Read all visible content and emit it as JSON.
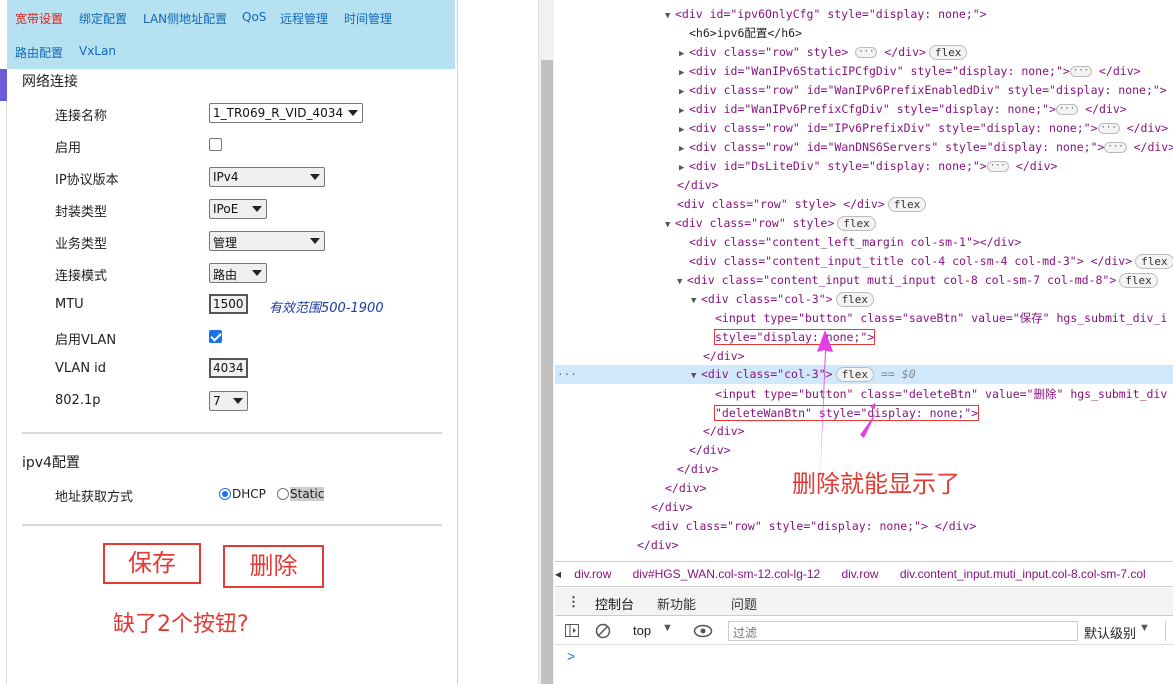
{
  "top_nav": {
    "tabs": [
      {
        "label": "宽带设置",
        "active": true
      },
      {
        "label": "绑定配置"
      },
      {
        "label": "LAN侧地址配置"
      },
      {
        "label": "QoS"
      },
      {
        "label": "远程管理"
      },
      {
        "label": "时间管理"
      },
      {
        "label": "路由配置"
      },
      {
        "label": "VxLan"
      }
    ]
  },
  "network": {
    "section_title": "网络连接",
    "fields": {
      "conn_name_label": "连接名称",
      "conn_name_value": "1_TR069_R_VID_4034",
      "enable_label": "启用",
      "ip_version_label": "IP协议版本",
      "ip_version_value": "IPv4",
      "encap_label": "封装类型",
      "encap_value": "IPoE",
      "service_label": "业务类型",
      "service_value": "管理",
      "mode_label": "连接模式",
      "mode_value": "路由",
      "mtu_label": "MTU",
      "mtu_value": "1500",
      "mtu_hint": "有效范围500-1900",
      "vlan_enable_label": "启用VLAN",
      "vlan_id_label": "VLAN id",
      "vlan_id_value": "4034",
      "dot1p_label": "802.1p",
      "dot1p_value": "7"
    }
  },
  "ipv4": {
    "section_title": "ipv4配置",
    "addr_label": "地址获取方式",
    "dhcp_label": "DHCP",
    "static_label": "Static"
  },
  "annotations": {
    "save": "保存",
    "delete": "删除",
    "missing_note": "缺了2个按钮?",
    "devtools_note": "删除就能显示了"
  },
  "devtools": {
    "lines": [
      "<div id=\"ipv6OnlyCfg\" style=\"display: none;\">",
      "<h6>ipv6配置</h6>",
      "<div class=\"row\" style>",
      "<div id=\"WanIPv6StaticIPCfgDiv\" style=\"display: none;\">",
      "<div class=\"row\" id=\"WanIPv6PrefixEnabledDiv\" style=\"display: none;\">",
      "<div id=\"WanIPv6PrefixCfgDiv\" style=\"display: none;\">",
      "<div class=\"row\" id=\"IPv6PrefixDiv\" style=\"display: none;\">",
      "<div class=\"row\" id=\"WanDNS6Servers\" style=\"display: none;\">",
      "<div id=\"DsLiteDiv\" style=\"display: none;\">",
      "</div>",
      "<div class=\"row\" style> </div>",
      "<div class=\"row\" style>",
      "<div class=\"content_left_margin col-sm-1\"></div>",
      "<div class=\"content_input_title col-4 col-sm-4 col-md-3\"> </div>",
      "<div class=\"content_input muti_input col-8 col-sm-7 col-md-8\">",
      "<div class=\"col-3\">",
      "<input type=\"button\" class=\"saveBtn\" value=\"保存\" hgs_submit_div_i",
      "style=\"display: none;\">",
      "</div>",
      "<div class=\"col-3\">",
      "<input type=\"button\" class=\"deleteBtn\" value=\"删除\" hgs_submit_div",
      "\"deleteWanBtn\" style=\"display: none;\">",
      "</div>",
      "</div>",
      "</div>",
      "</div>",
      "</div>",
      "<div class=\"row\" style=\"display: none;\"> </div>",
      "</div>"
    ],
    "badge_flex": "flex",
    "selected_marker": "== $0",
    "breadcrumbs": [
      "div.row",
      "div#HGS_WAN.col-sm-12.col-lg-12",
      "div.row",
      "div.content_input.muti_input.col-8.col-sm-7.col"
    ],
    "drawer_tabs": [
      "控制台",
      "新功能",
      "问题"
    ],
    "context": "top",
    "filter_placeholder": "过滤",
    "level": "默认级别",
    "prompt": ">"
  }
}
